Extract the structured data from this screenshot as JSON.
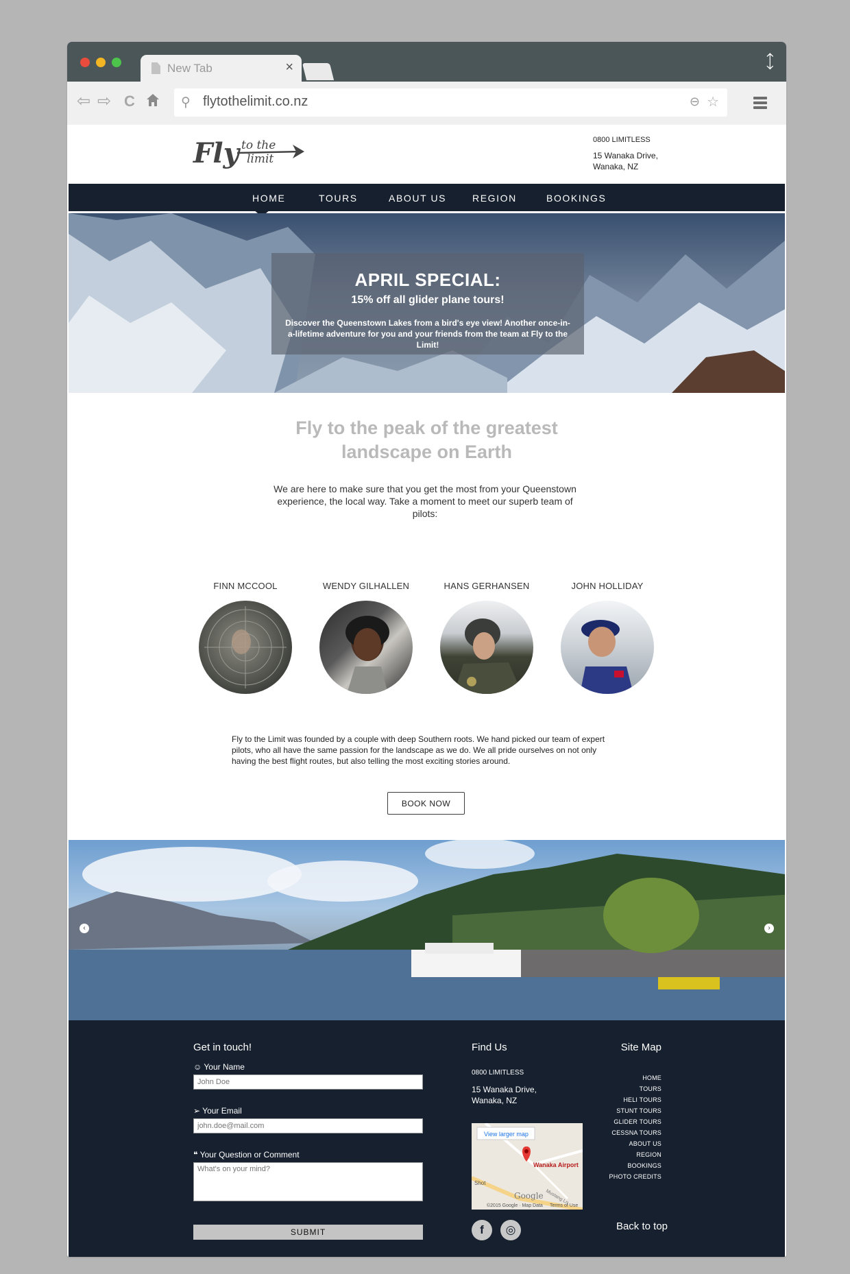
{
  "browser": {
    "tab_title": "New Tab",
    "tab_close": "×",
    "url": "flytothelimit.co.nz",
    "back": "⇦",
    "forward": "⇨",
    "reload": "C",
    "expand": "⤢"
  },
  "site": {
    "logo": {
      "line1": "to the",
      "big": "Fly",
      "line2": "limit"
    },
    "contact": {
      "phone": "0800 LIMITLESS",
      "address1": "15 Wanaka Drive,",
      "address2": "Wanaka, NZ"
    },
    "nav": [
      "HOME",
      "TOURS",
      "ABOUT US",
      "REGION",
      "BOOKINGS"
    ],
    "hero": {
      "title": "APRIL SPECIAL:",
      "subtitle": "15% off all glider plane tours!",
      "text": "Discover the Queenstown Lakes from a bird's eye view! Another once-in-a-lifetime adventure for you and your friends from the team at Fly to the Limit!"
    },
    "headline_1": "Fly to the peak of the greatest",
    "headline_2": "landscape on Earth",
    "intro": "We are here to make sure that you get the most from your Queenstown experience, the local way. Take a moment to meet our superb team of pilots:",
    "pilots": [
      "FINN MCCOOL",
      "WENDY GILHALLEN",
      "HANS GERHANSEN",
      "JOHN HOLLIDAY"
    ],
    "about": "Fly to the Limit was founded by a couple with deep Southern roots. We hand picked our team of expert pilots, who all have the same passion for the landscape as we do. We all pride ourselves on not only having the best flight routes, but also telling the most exciting stories around.",
    "book_now": "BOOK NOW",
    "carousel": {
      "prev": "‹",
      "next": "›"
    }
  },
  "footer": {
    "contact_title": "Get in touch!",
    "name_label": "Your Name",
    "name_placeholder": "John Doe",
    "email_label": "Your Email",
    "email_placeholder": "john.doe@mail.com",
    "comment_label": "Your Question or Comment",
    "comment_placeholder": "What's on your mind?",
    "submit": "SUBMIT",
    "find_title": "Find Us",
    "phone": "0800 LIMITLESS",
    "address1": "15 Wanaka Drive,",
    "address2": "Wanaka, NZ",
    "map": {
      "link": "View larger map",
      "place": "Wanaka Airport",
      "road1": "Mustang Ln",
      "shot": "Shot",
      "brand": "Google",
      "copyright": "©2015 Google · Map Data",
      "terms": "Terms of Use"
    },
    "social": [
      "f",
      "◎"
    ],
    "sitemap_title": "Site Map",
    "sitemap": [
      "HOME",
      "TOURS",
      "HELI TOURS",
      "STUNT TOURS",
      "GLIDER TOURS",
      "CESSNA TOURS",
      "ABOUT US",
      "REGION",
      "BOOKINGS",
      "PHOTO CREDITS"
    ],
    "back_to_top": "Back to top"
  },
  "colors": {
    "navy": "#16202e",
    "chrome": "#4a5658",
    "grey_headline": "#b9b9b9"
  }
}
